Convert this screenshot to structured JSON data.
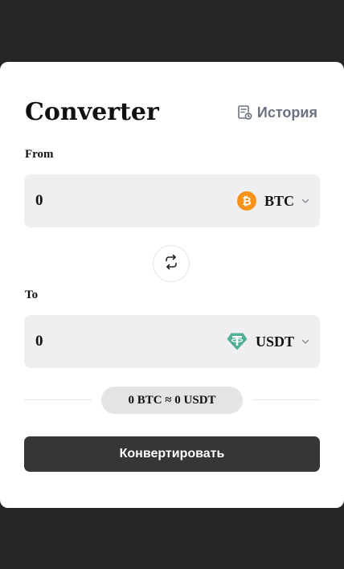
{
  "header": {
    "title": "Converter",
    "history_label": "История",
    "history_icon": "history-icon"
  },
  "from": {
    "label": "From",
    "amount": "0",
    "currency": "BTC",
    "coin_icon": "bitcoin-icon",
    "coin_color": "#F7931A"
  },
  "swap": {
    "icon": "swap-icon"
  },
  "to": {
    "label": "To",
    "amount": "0",
    "currency": "USDT",
    "coin_icon": "tether-icon",
    "coin_color": "#50AF95"
  },
  "rate": {
    "text": "0 BTC ≈ 0 USDT"
  },
  "actions": {
    "convert_label": "Конвертировать"
  },
  "colors": {
    "backdrop": "#262626",
    "card": "#ffffff",
    "field_bg": "#efeff1",
    "button_bg": "#363636",
    "muted_text": "#6b7280"
  }
}
